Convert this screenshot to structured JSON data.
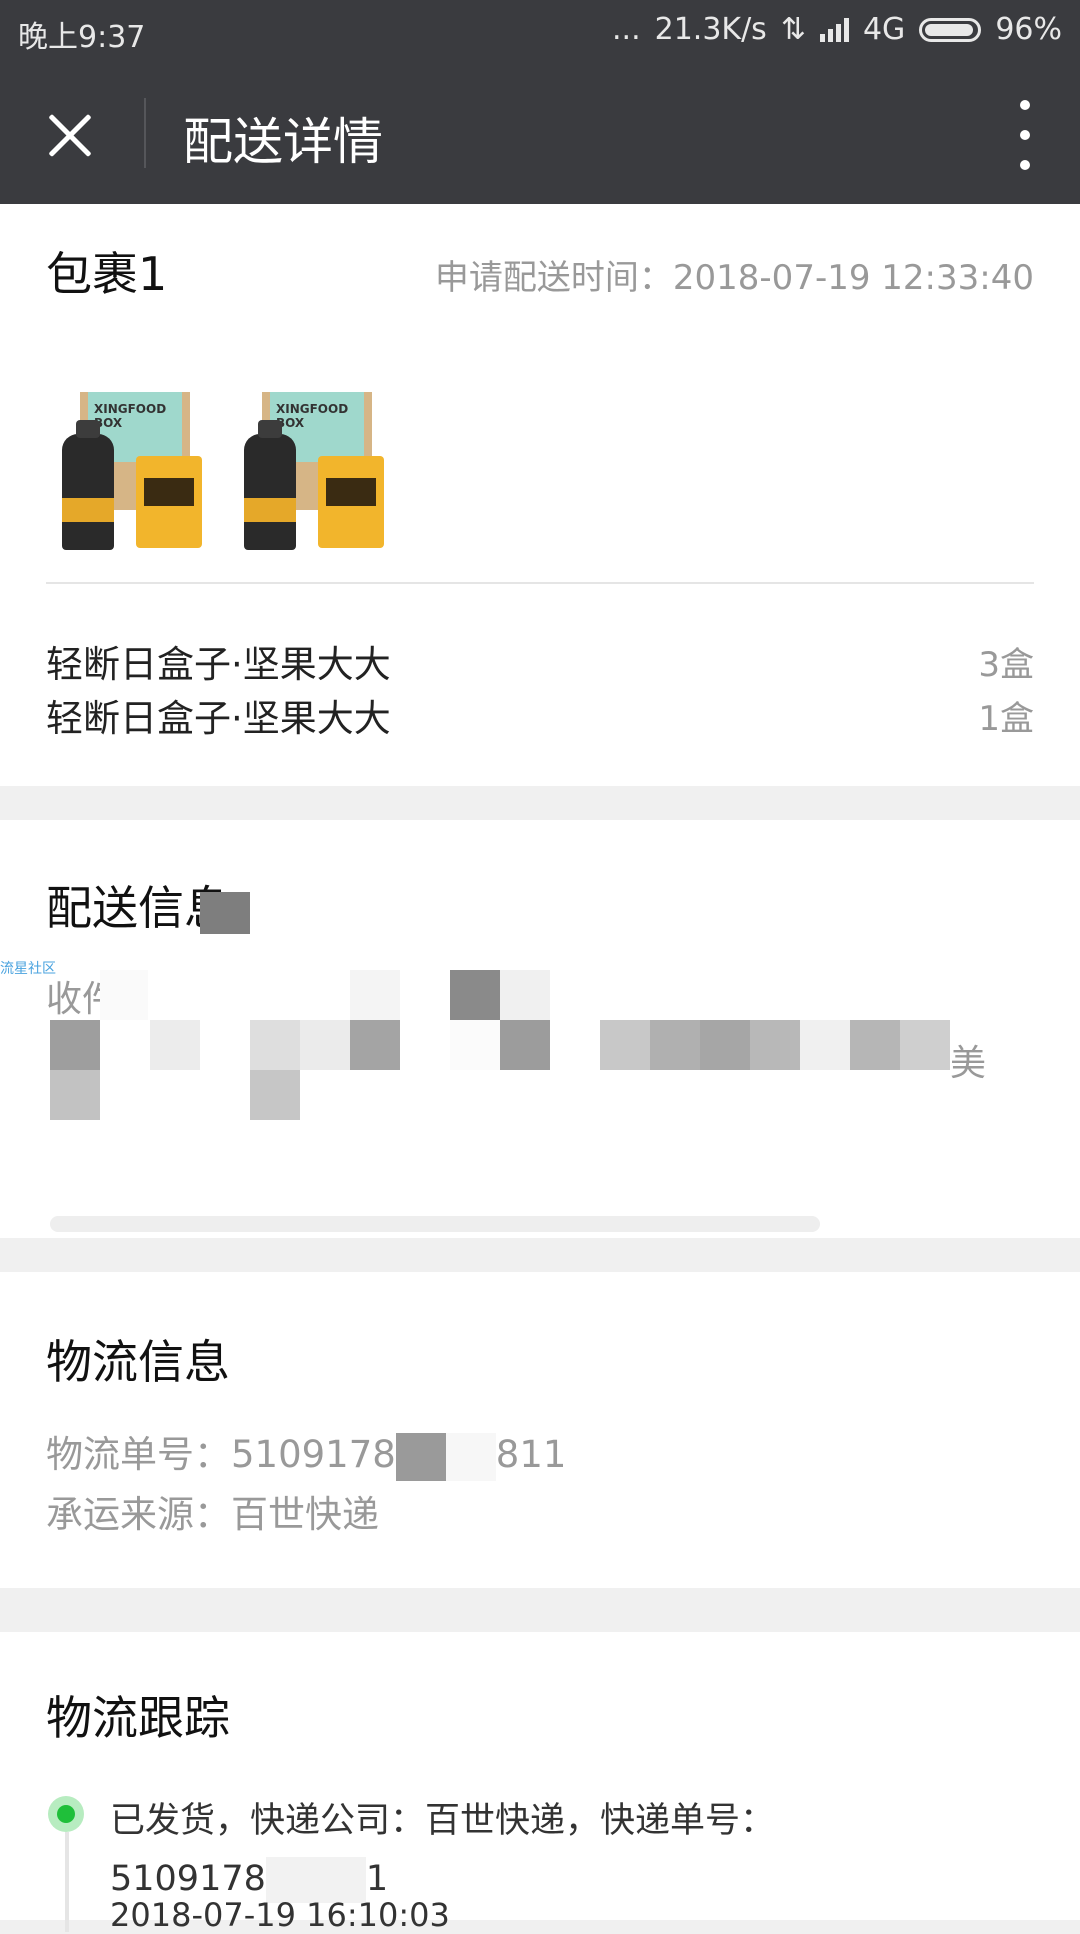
{
  "status_bar": {
    "time": "晚上9:37",
    "dots": "...",
    "speed": "21.3K/s",
    "network": "4G",
    "battery": "96%"
  },
  "header": {
    "title": "配送详情",
    "close_icon": "close-icon",
    "more_icon": "more-vertical-icon"
  },
  "package": {
    "title": "包裹1",
    "apply_time_label": "申请配送时间：",
    "apply_time": "2018-07-19 12:33:40",
    "product_images": [
      {
        "box_label": "XINGFOOD BOX"
      },
      {
        "box_label": "XINGFOOD BOX"
      }
    ],
    "items": [
      {
        "name": "轻断日盒子·坚果大大",
        "qty": "3盒"
      },
      {
        "name": "轻断日盒子·坚果大大",
        "qty": "1盒"
      }
    ]
  },
  "delivery": {
    "title": "配送信息",
    "receiver_label": "收件",
    "receiver_tail": "美",
    "watermark": "流星社区"
  },
  "logistics": {
    "title": "物流信息",
    "number_label": "物流单号：",
    "number_prefix": "5109178",
    "number_suffix": "811",
    "carrier_label": "承运来源：",
    "carrier": "百世快递"
  },
  "tracking": {
    "title": "物流跟踪",
    "event_line1": "已发货，快递公司：百世快递，快递单号：",
    "event_number_prefix": "5109178",
    "event_number_suffix": "1",
    "event_time": "2018-07-19 16:10:03"
  }
}
